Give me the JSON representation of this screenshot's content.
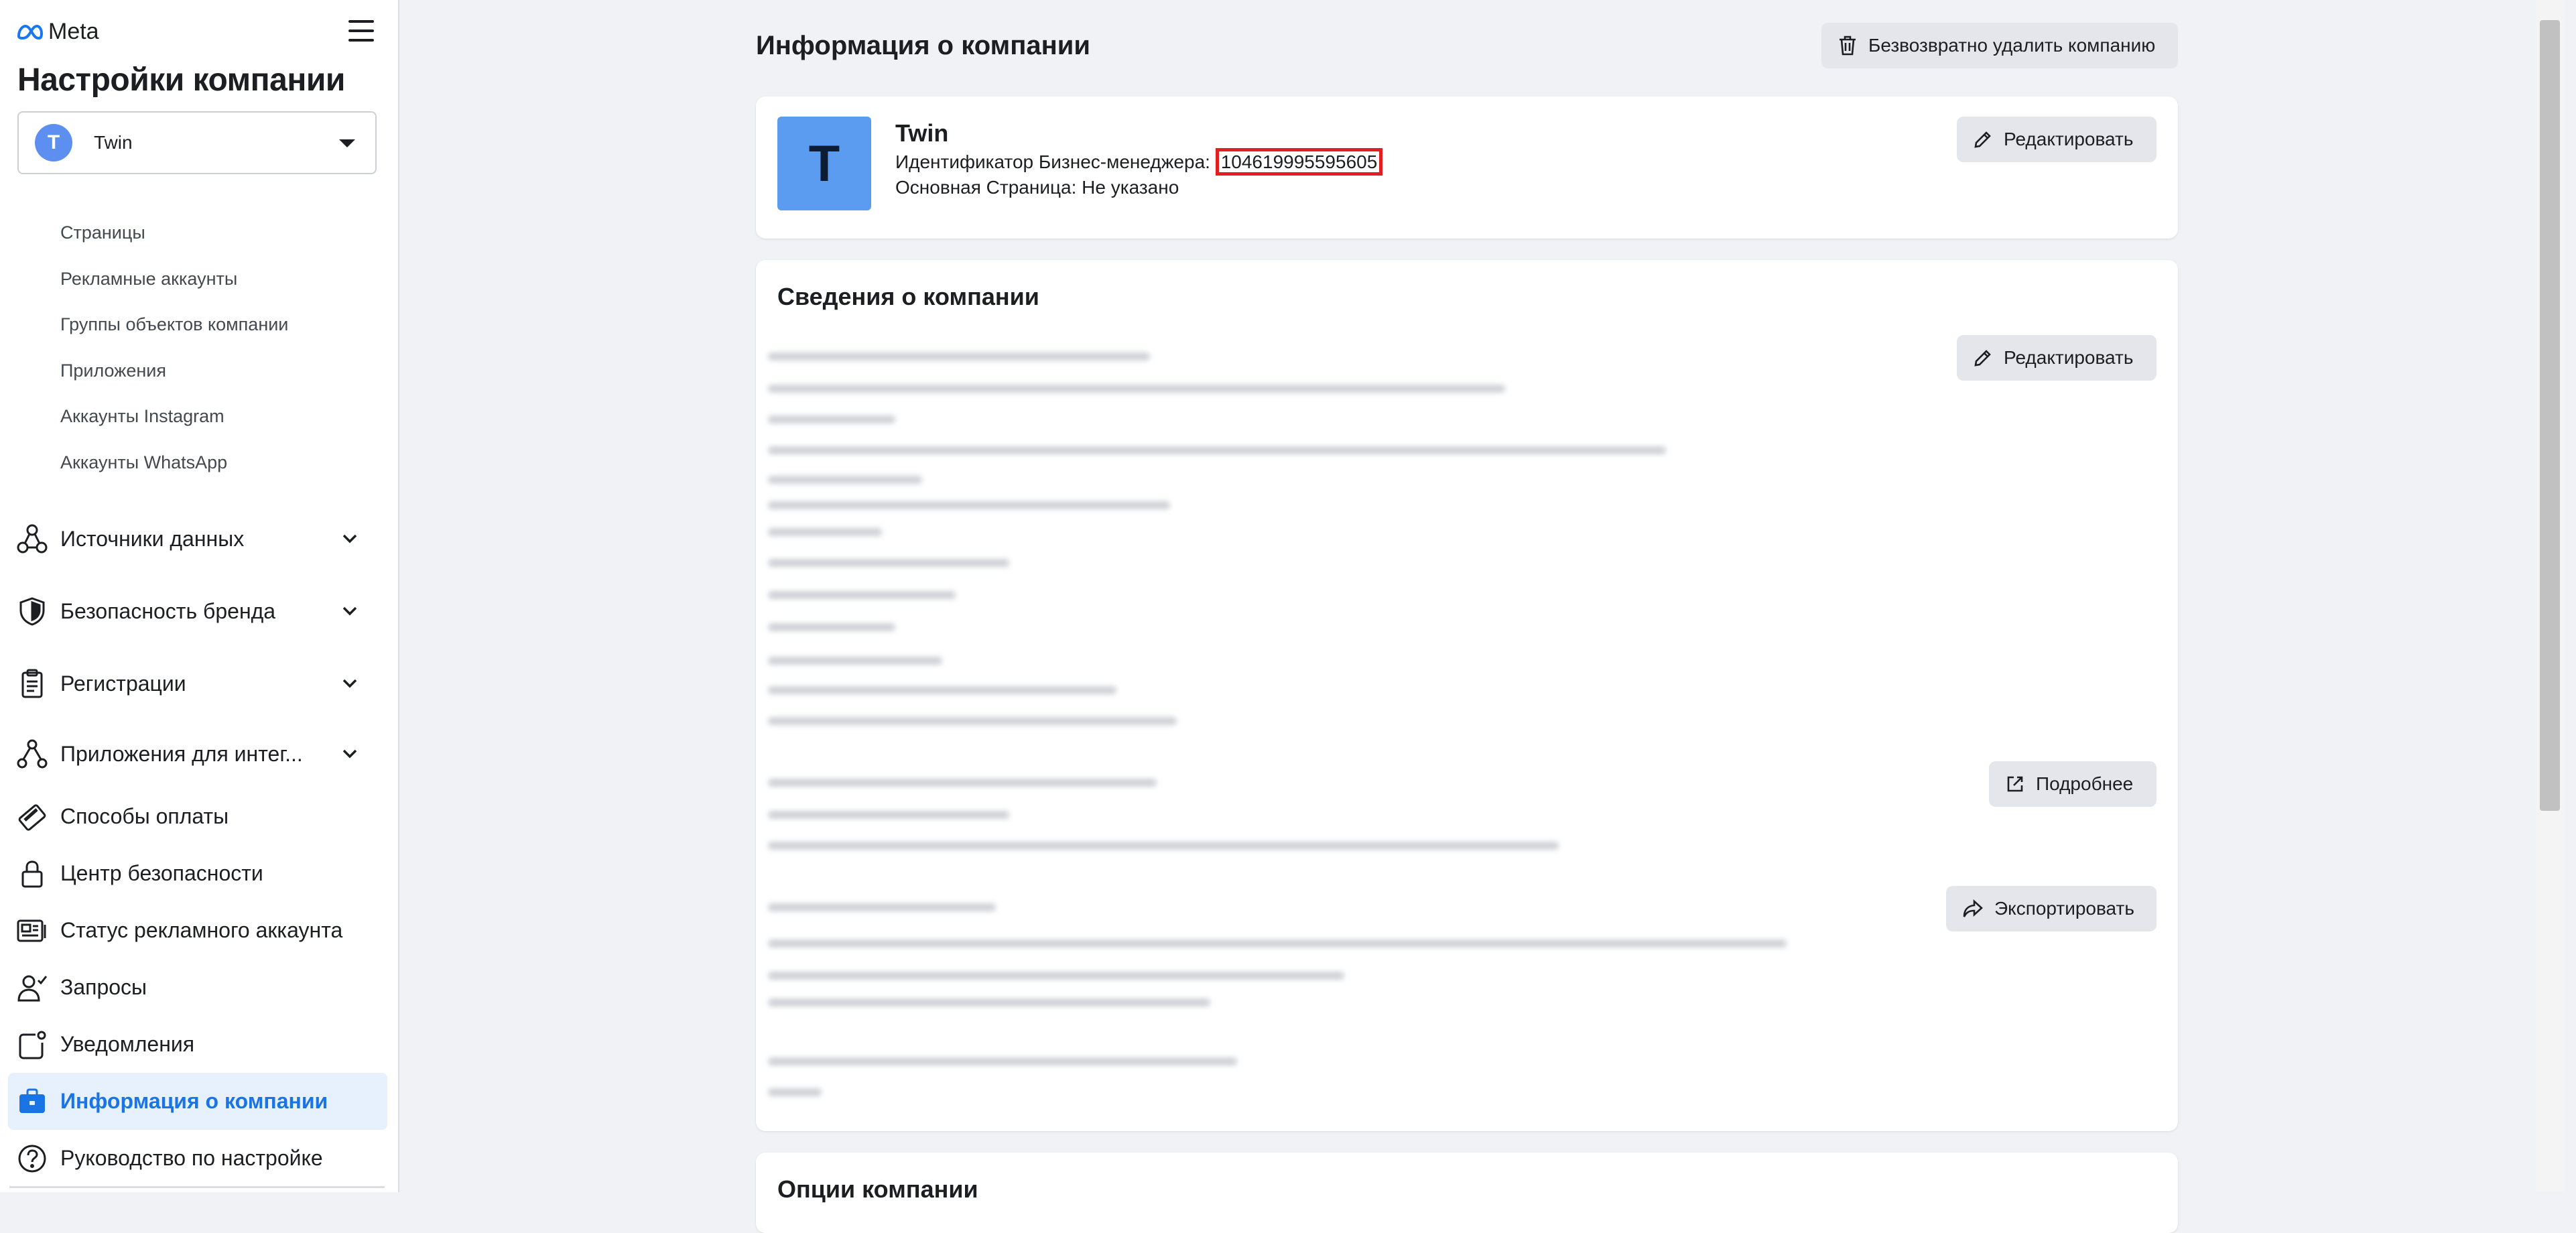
{
  "brand": {
    "name": "Meta",
    "color": "#1877f2"
  },
  "sidebar": {
    "title": "Настройки компании",
    "company": {
      "initial": "T",
      "name": "Twin"
    },
    "subitems": [
      "Страницы",
      "Рекламные аккаунты",
      "Группы объектов компании",
      "Приложения",
      "Аккаунты Instagram",
      "Аккаунты WhatsApp"
    ],
    "nav": [
      {
        "label": "Источники данных",
        "icon": "data-sources-icon",
        "expandable": true
      },
      {
        "label": "Безопасность бренда",
        "icon": "shield-icon",
        "expandable": true
      },
      {
        "label": "Регистрации",
        "icon": "clipboard-icon",
        "expandable": true
      },
      {
        "label": "Приложения для интег...",
        "icon": "integrations-icon",
        "expandable": true
      },
      {
        "label": "Способы оплаты",
        "icon": "credit-card-icon",
        "expandable": false
      },
      {
        "label": "Центр безопасности",
        "icon": "lock-icon",
        "expandable": false
      },
      {
        "label": "Статус рекламного аккаунта",
        "icon": "ad-account-status-icon",
        "expandable": false
      },
      {
        "label": "Запросы",
        "icon": "person-check-icon",
        "expandable": false
      },
      {
        "label": "Уведомления",
        "icon": "notifications-icon",
        "expandable": false
      },
      {
        "label": "Информация о компании",
        "icon": "briefcase-icon",
        "expandable": false,
        "active": true
      },
      {
        "label": "Руководство по настройке",
        "icon": "help-icon",
        "expandable": false
      }
    ],
    "active_color": "#1b74e4"
  },
  "main": {
    "heading": "Информация о компании",
    "delete_button": "Безвозвратно удалить компанию",
    "company_card": {
      "initial": "T",
      "name": "Twin",
      "id_label": "Идентификатор Бизнес-менеджера:",
      "id_value": "104619995595605",
      "page_label": "Основная Страница: Не указано",
      "edit_button": "Редактировать"
    },
    "details_card": {
      "title": "Сведения о компании",
      "edit_button": "Редактировать",
      "more_button": "Подробнее",
      "export_button": "Экспортировать"
    },
    "options_card": {
      "title": "Опции компании"
    }
  }
}
